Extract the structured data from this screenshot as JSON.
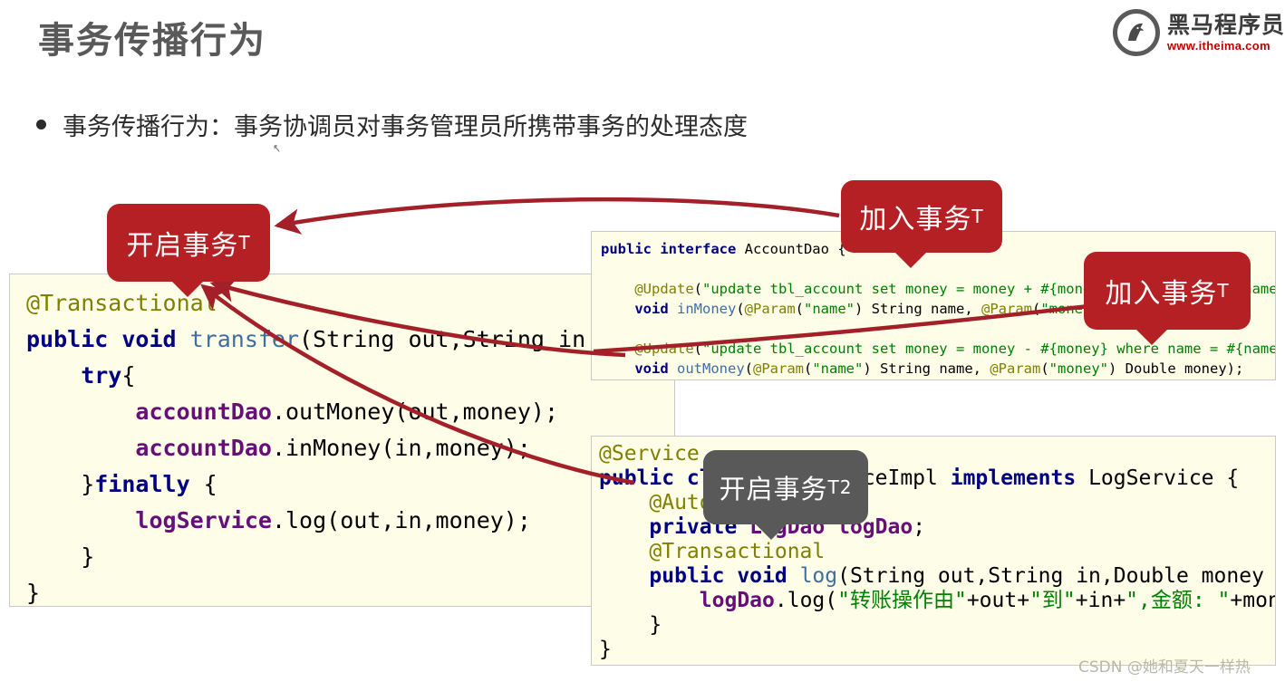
{
  "slide": {
    "title": "事务传播行为",
    "bullet": "事务传播行为：事务协调员对事务管理员所携带事务的处理态度",
    "cursor_glyph": "↖"
  },
  "logo": {
    "name": "黑马程序员",
    "url": "www.itheima.com",
    "mark_icon": "horse-head-icon"
  },
  "code_panels": {
    "service": {
      "lines": [
        "@Transactional",
        "public void transfer(String out,String in ,Double money){",
        "    try{",
        "        accountDao.outMoney(out,money);",
        "        accountDao.inMoney(in,money);",
        "    }finally {",
        "        logService.log(out,in,money);",
        "    }",
        "}"
      ]
    },
    "dao": {
      "lines": [
        "public interface AccountDao {",
        "",
        "    @Update(\"update tbl_account set money = money + #{money} where name = #{name}\")",
        "    void inMoney(@Param(\"name\") String name, @Param(\"money\") Double money);",
        "",
        "    @Update(\"update tbl_account set money = money - #{money} where name = #{name}\")",
        "    void outMoney(@Param(\"name\") String name, @Param(\"money\") Double money);",
        "}"
      ]
    },
    "log": {
      "lines": [
        "@Service",
        "public class LogServiceImpl implements LogService {",
        "    @Autowired",
        "    private LogDao logDao;",
        "    @Transactional",
        "    public void log(String out,String in,Double money ) {",
        "        logDao.log(\"转账操作由\"+out+\"到\"+in+\",金额: \"+money);",
        "    }",
        "}"
      ]
    }
  },
  "callouts": {
    "start_t": {
      "label": "开启事务",
      "sub": "T",
      "color": "#b52025"
    },
    "join_t1": {
      "label": "加入事务",
      "sub": "T",
      "color": "#b52025"
    },
    "join_t2": {
      "label": "加入事务",
      "sub": "T",
      "color": "#b52025"
    },
    "start_t2": {
      "label": "开启事务",
      "sub": "T2",
      "color": "#595959"
    }
  },
  "arrows": {
    "color": "#a32028"
  },
  "watermark": "CSDN @她和夏天一样热"
}
